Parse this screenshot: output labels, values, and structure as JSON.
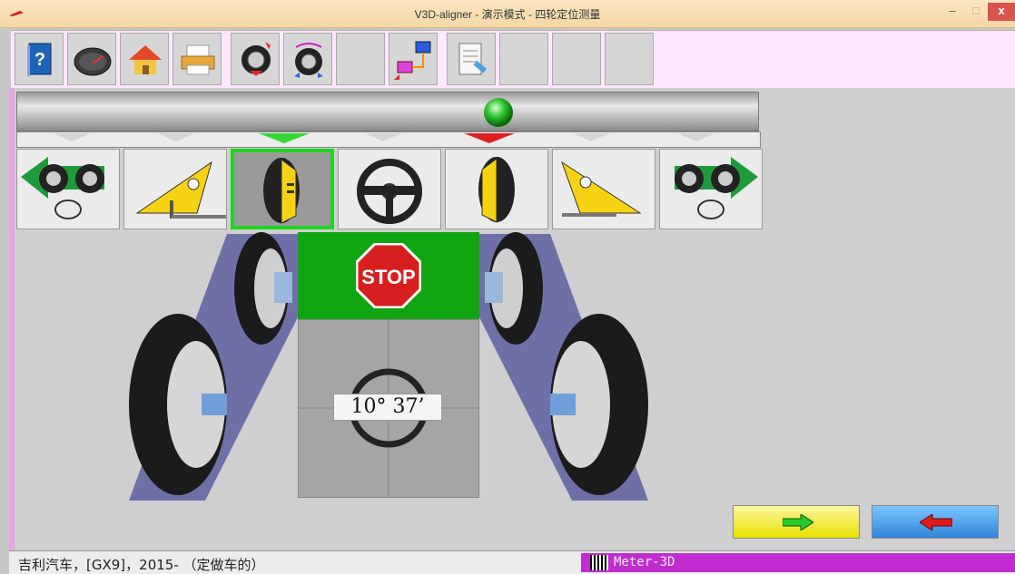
{
  "window": {
    "title": "V3D-aligner - 演示模式 - 四轮定位测量",
    "minimize": "–",
    "maximize": "□",
    "close": "x"
  },
  "toolbar": {
    "buttons": [
      {
        "name": "help",
        "icon": "help-book-icon"
      },
      {
        "name": "gauge",
        "icon": "speedometer-icon"
      },
      {
        "name": "home",
        "icon": "home-icon"
      },
      {
        "name": "print",
        "icon": "printer-icon"
      },
      {
        "name": "wheel-rotate",
        "icon": "wheel-rotate-icon"
      },
      {
        "name": "wheel-compensate",
        "icon": "wheel-compensate-icon"
      },
      {
        "name": "empty-1",
        "icon": ""
      },
      {
        "name": "connection",
        "icon": "monitor-connection-icon"
      },
      {
        "name": "report",
        "icon": "report-document-icon"
      },
      {
        "name": "empty-2",
        "icon": ""
      },
      {
        "name": "empty-3",
        "icon": ""
      },
      {
        "name": "empty-4",
        "icon": ""
      }
    ]
  },
  "steps": [
    {
      "name": "rear-to-front",
      "icon": "wheels-arrow-left-icon",
      "active": false
    },
    {
      "name": "rear-axle",
      "icon": "rear-axle-triangle-icon",
      "active": false
    },
    {
      "name": "left-wheel-adjust",
      "icon": "wheel-camber-icon",
      "active": true
    },
    {
      "name": "steering",
      "icon": "steering-wheel-icon",
      "active": false
    },
    {
      "name": "right-wheel-adjust",
      "icon": "wheel-camber-icon",
      "active": false
    },
    {
      "name": "front-axle",
      "icon": "front-axle-triangle-icon",
      "active": false
    },
    {
      "name": "front-to-rear",
      "icon": "wheels-arrow-right-icon",
      "active": false
    }
  ],
  "indicators": {
    "green_marker": "#34d634",
    "red_marker": "#e02020",
    "status_light": "#2ec02e"
  },
  "stop_sign": {
    "text": "STOP",
    "color": "#d81f1f"
  },
  "steering_reading": "10° 37’",
  "colors": {
    "green_panel": "#12a512",
    "lane": "#6f6fa8",
    "next_button": "#f4ee4a",
    "prev_button": "#2f83d8",
    "status_accent": "#c02ccf"
  },
  "buttons": {
    "next": "next-arrow-icon",
    "previous": "previous-arrow-icon"
  },
  "status": {
    "vehicle": "吉利汽车，[GX9]，2015- （定做车的）",
    "device": "Meter-3D"
  }
}
